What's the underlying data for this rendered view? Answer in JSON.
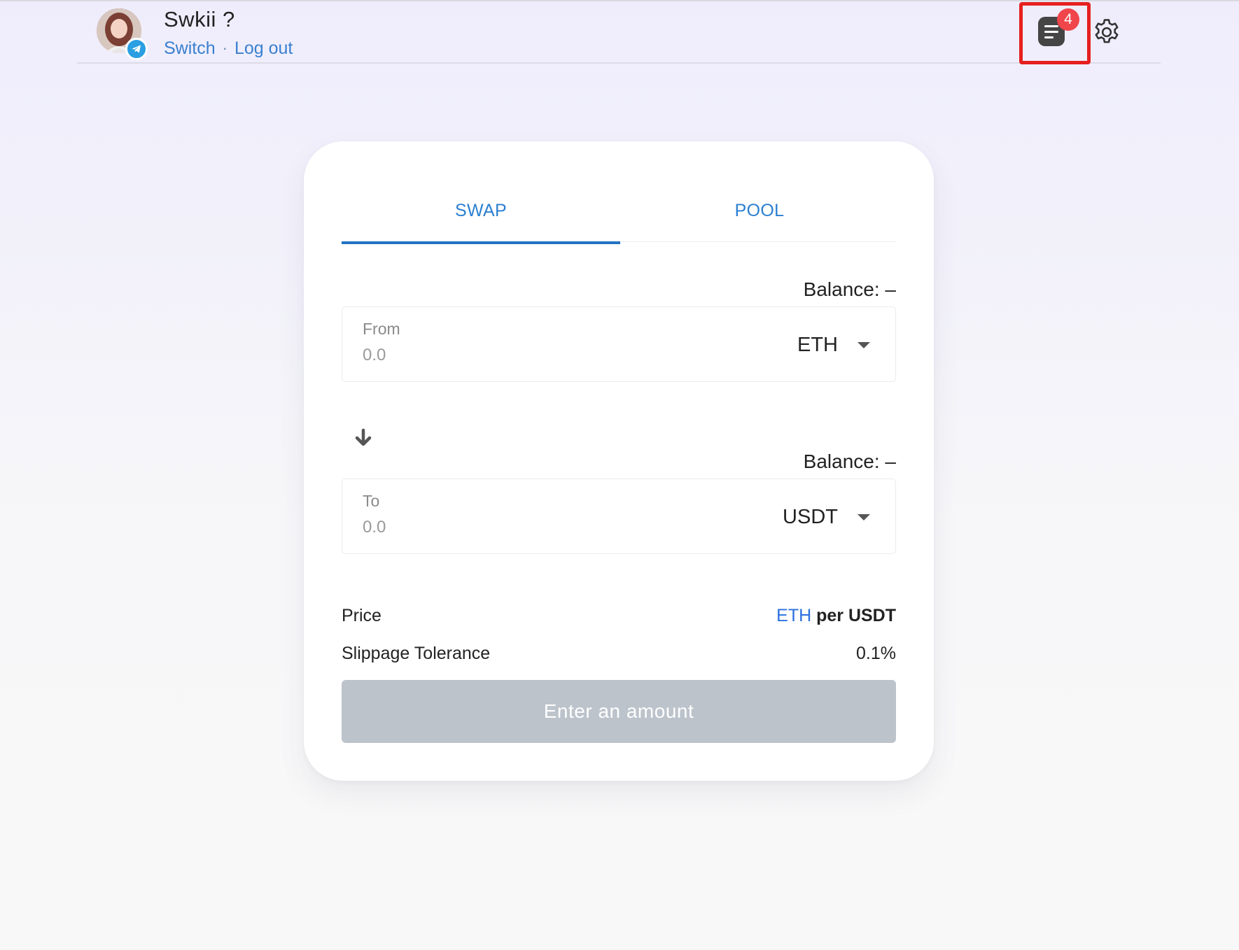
{
  "header": {
    "username": "Swkii ?",
    "switch_label": "Switch",
    "separator": "·",
    "logout_label": "Log out",
    "notification_count": "4",
    "icons": [
      "telegram-icon",
      "document-list-icon",
      "gear-icon"
    ]
  },
  "tabs": [
    {
      "label": "SWAP",
      "active": true
    },
    {
      "label": "POOL",
      "active": false
    }
  ],
  "from": {
    "balance": "Balance: –",
    "label": "From",
    "value": "0.0",
    "token": "ETH"
  },
  "to": {
    "balance": "Balance: –",
    "label": "To",
    "value": "0.0",
    "token": "USDT"
  },
  "price": {
    "label": "Price",
    "base": "ETH",
    "rest": "per USDT"
  },
  "slippage": {
    "label": "Slippage Tolerance",
    "value": "0.1%"
  },
  "cta_label": "Enter an amount",
  "colors": {
    "accent": "#2b7fd0",
    "tab_underline": "#2372c2",
    "badge": "#f0454a",
    "highlight": "#e5201f",
    "cta_disabled": "#bcc3cb"
  }
}
